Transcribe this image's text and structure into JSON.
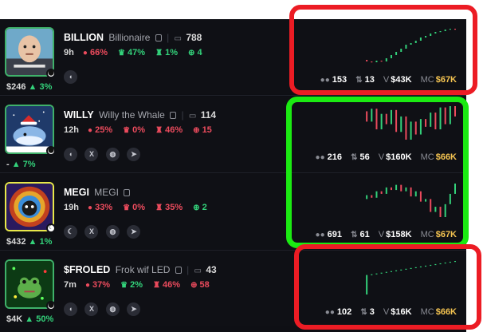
{
  "rows": [
    {
      "ticker": "BILLION",
      "name": "Billionaire",
      "comments": "788",
      "age": "9h",
      "stat_holders": "66%",
      "stat_chef": "47%",
      "stat_whale": "1%",
      "stat_target": "4",
      "mc_under": "$246",
      "mc_change": "3%",
      "avatar_border": "#3fb16a",
      "socials": [
        "pill-icon"
      ],
      "holders": "153",
      "txs": "13",
      "volume": "$43K",
      "mc": "$67K",
      "spark": [
        1.2,
        1.0,
        0.9,
        1.1,
        1.0,
        1.4,
        1.8,
        2.2,
        2.6,
        3.1,
        3.3,
        3.6,
        4.0,
        4.2,
        4.5,
        4.7,
        4.8,
        5.0,
        5.1,
        5.0
      ]
    },
    {
      "ticker": "WILLY",
      "name": "Willy the Whale",
      "comments": "114",
      "age": "12h",
      "stat_holders": "25%",
      "stat_chef": "0%",
      "stat_whale": "46%",
      "stat_target": "15",
      "mc_under": "-",
      "mc_change": "7%",
      "avatar_border": "#3fb16a",
      "socials": [
        "pill-icon",
        "x-icon",
        "globe-icon",
        "telegram-icon"
      ],
      "holders": "216",
      "txs": "56",
      "volume": "$160K",
      "mc": "$66K",
      "spark": [
        4.0,
        3.2,
        4.2,
        2.6,
        3.8,
        3.0,
        4.1,
        2.4,
        3.6,
        1.8,
        3.2,
        2.2,
        3.4,
        2.8,
        3.9,
        2.6,
        4.3,
        3.0,
        4.4,
        3.6
      ]
    },
    {
      "ticker": "MEGI",
      "name": "MEGI",
      "comments": "",
      "age": "19h",
      "stat_holders": "33%",
      "stat_chef": "0%",
      "stat_whale": "35%",
      "stat_target": "2",
      "mc_under": "$432",
      "mc_change": "1%",
      "avatar_border": "#e8e84a",
      "socials": [
        "moon-icon",
        "x-icon",
        "globe-icon",
        "telegram-icon"
      ],
      "holders": "691",
      "txs": "61",
      "volume": "$158K",
      "mc": "$67K",
      "spark": [
        3.0,
        3.3,
        3.1,
        3.6,
        3.4,
        3.9,
        3.7,
        4.1,
        3.6,
        3.9,
        3.2,
        3.6,
        2.8,
        3.0,
        2.0,
        2.4,
        1.6,
        2.6,
        3.4,
        4.2
      ]
    },
    {
      "ticker": "$FROLED",
      "name": "Frok wif LED",
      "comments": "43",
      "age": "7m",
      "stat_holders": "37%",
      "stat_chef": "2%",
      "stat_whale": "46%",
      "stat_target": "58",
      "mc_under": "$4K",
      "mc_change": "50%",
      "avatar_border": "#3fb16a",
      "socials": [
        "pill-icon",
        "x-icon",
        "globe-icon",
        "telegram-icon"
      ],
      "holders": "102",
      "txs": "3",
      "volume": "$16K",
      "mc": "$66K",
      "spark": [
        0.5,
        3.0,
        3.1,
        3.2,
        3.3,
        3.4,
        3.5,
        3.6,
        3.7,
        3.8,
        3.9,
        4.0,
        4.1,
        4.2,
        4.3,
        4.4,
        4.5,
        4.6,
        4.7,
        4.8
      ]
    }
  ],
  "labels": {
    "volume_prefix": "V",
    "mc_prefix": "MC"
  },
  "colors": {
    "up": "#33d17a",
    "down": "#ec4b5d",
    "mc": "#f5c451",
    "annotation_red": "#ec1c24",
    "annotation_green": "#1bea12"
  }
}
